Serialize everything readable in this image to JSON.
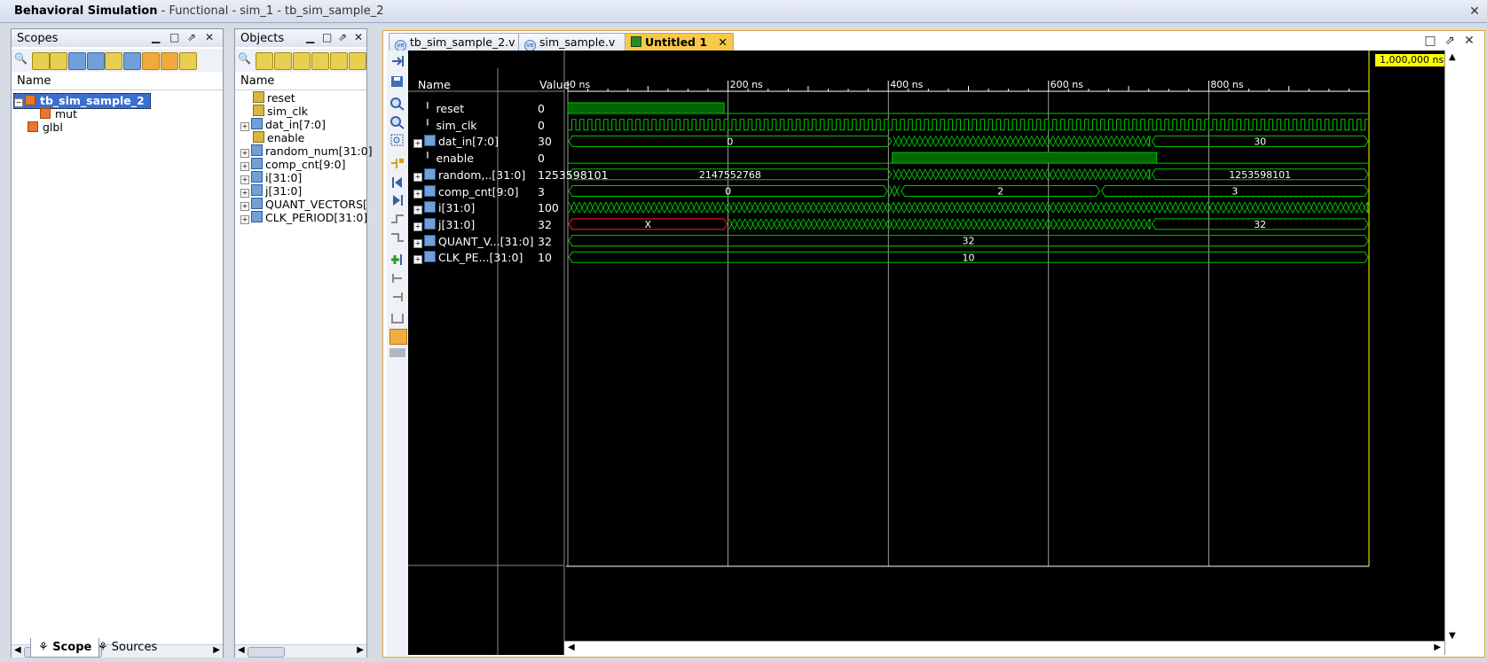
{
  "window": {
    "title_bold": "Behavioral Simulation",
    "title_rest": " - Functional - sim_1 - tb_sim_sample_2"
  },
  "scopes": {
    "title": "Scopes",
    "col_name": "Name",
    "tree": [
      {
        "label": "tb_sim_sample_2",
        "selected": true,
        "expanded": true
      },
      {
        "label": "mut"
      },
      {
        "label": "glbl"
      }
    ]
  },
  "objects": {
    "title": "Objects",
    "col_name": "Name",
    "items": [
      {
        "label": "reset",
        "type": "signal"
      },
      {
        "label": "sim_clk",
        "type": "signal"
      },
      {
        "label": "dat_in[7:0]",
        "type": "bus"
      },
      {
        "label": "enable",
        "type": "signal"
      },
      {
        "label": "random_num[31:0]",
        "type": "bus"
      },
      {
        "label": "comp_cnt[9:0]",
        "type": "bus"
      },
      {
        "label": "i[31:0]",
        "type": "bus"
      },
      {
        "label": "j[31:0]",
        "type": "bus"
      },
      {
        "label": "QUANT_VECTORS[",
        "type": "bus"
      },
      {
        "label": "CLK_PERIOD[31:0]",
        "type": "bus"
      }
    ]
  },
  "bottom_tabs": [
    {
      "label": "Scope",
      "active": true
    },
    {
      "label": "Sources",
      "active": false
    }
  ],
  "doc_tabs": [
    {
      "label": "tb_sim_sample_2.v",
      "active": false
    },
    {
      "label": "sim_sample.v",
      "active": false
    },
    {
      "label": "Untitled 1",
      "active": true
    }
  ],
  "wave": {
    "col_name": "Name",
    "col_value": "Value",
    "cursor_label": "1,000,000 ns",
    "time_ticks": [
      "0 ns",
      "200 ns",
      "400 ns",
      "600 ns",
      "800 ns"
    ],
    "signals": [
      {
        "name": "reset",
        "value": "0",
        "kind": "bit",
        "segments": [
          {
            "from": 0,
            "to": 195,
            "level": 1
          },
          {
            "from": 195,
            "to": 1000,
            "level": 0
          }
        ]
      },
      {
        "name": "sim_clk",
        "value": "0",
        "kind": "clk",
        "period": 10
      },
      {
        "name": "dat_in[7:0]",
        "value": "30",
        "kind": "bus",
        "segments": [
          {
            "from": 0,
            "to": 405,
            "label": "0"
          },
          {
            "from": 405,
            "to": 728,
            "label": "",
            "dense": true
          },
          {
            "from": 728,
            "to": 1000,
            "label": "30"
          }
        ]
      },
      {
        "name": "enable",
        "value": "0",
        "kind": "bit",
        "segments": [
          {
            "from": 0,
            "to": 405,
            "level": 0
          },
          {
            "from": 405,
            "to": 735,
            "level": 1
          },
          {
            "from": 735,
            "to": 1000,
            "level": 0
          }
        ]
      },
      {
        "name": "random,..[31:0]",
        "value": "1253598101",
        "kind": "bus",
        "segments": [
          {
            "from": 0,
            "to": 405,
            "label": "2147552768"
          },
          {
            "from": 405,
            "to": 728,
            "label": "",
            "dense": true
          },
          {
            "from": 728,
            "to": 1000,
            "label": "1253598101"
          }
        ]
      },
      {
        "name": "comp_cnt[9:0]",
        "value": "3",
        "kind": "bus",
        "segments": [
          {
            "from": 0,
            "to": 400,
            "label": "0"
          },
          {
            "from": 400,
            "to": 415,
            "label": "",
            "dense": true
          },
          {
            "from": 415,
            "to": 665,
            "label": "2"
          },
          {
            "from": 665,
            "to": 1000,
            "label": "3"
          }
        ]
      },
      {
        "name": "i[31:0]",
        "value": "100",
        "kind": "bus",
        "segments": [
          {
            "from": 0,
            "to": 1000,
            "label": "",
            "dense": true
          }
        ]
      },
      {
        "name": "j[31:0]",
        "value": "32",
        "kind": "bus",
        "segments": [
          {
            "from": 0,
            "to": 200,
            "label": "X",
            "red": true
          },
          {
            "from": 200,
            "to": 728,
            "label": "",
            "dense": true
          },
          {
            "from": 728,
            "to": 1000,
            "label": "32"
          }
        ]
      },
      {
        "name": "QUANT_V...[31:0]",
        "value": "32",
        "kind": "bus",
        "segments": [
          {
            "from": 0,
            "to": 1000,
            "label": "32"
          }
        ]
      },
      {
        "name": "CLK_PE...[31:0]",
        "value": "10",
        "kind": "bus",
        "segments": [
          {
            "from": 0,
            "to": 1000,
            "label": "10"
          }
        ]
      }
    ],
    "colors": {
      "wave": "#00c800",
      "grid": "#ffffff",
      "marker": "#ffff00",
      "red": "#ff2020"
    }
  }
}
